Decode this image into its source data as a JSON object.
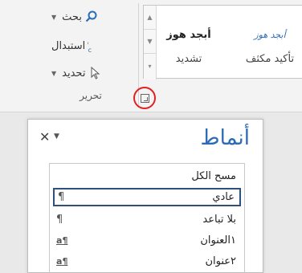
{
  "ribbon": {
    "editing": {
      "group_label": "تحرير",
      "find_label": "بحث",
      "replace_label": "استبدال",
      "select_label": "تحديد"
    },
    "styles_gallery": {
      "tiles": [
        {
          "top": "أبجد هوز",
          "bottom": "تشديد"
        },
        {
          "top": "أبجد هوز",
          "bottom": "تأكيد مكثف"
        }
      ]
    }
  },
  "styles_pane": {
    "title": "أنماط",
    "close_glyph": "✕",
    "menu_glyph": "▼",
    "items": [
      {
        "label": "مسح الكل",
        "mark": ""
      },
      {
        "label": "عادي",
        "mark": "¶"
      },
      {
        "label": "بلا تباعد",
        "mark": "¶"
      },
      {
        "label": "١العنوان",
        "mark": "¶a"
      },
      {
        "label": "٢عنوان",
        "mark": "¶a"
      }
    ]
  },
  "colors": {
    "accent": "#2b6cb5",
    "highlight": "#e02020"
  }
}
